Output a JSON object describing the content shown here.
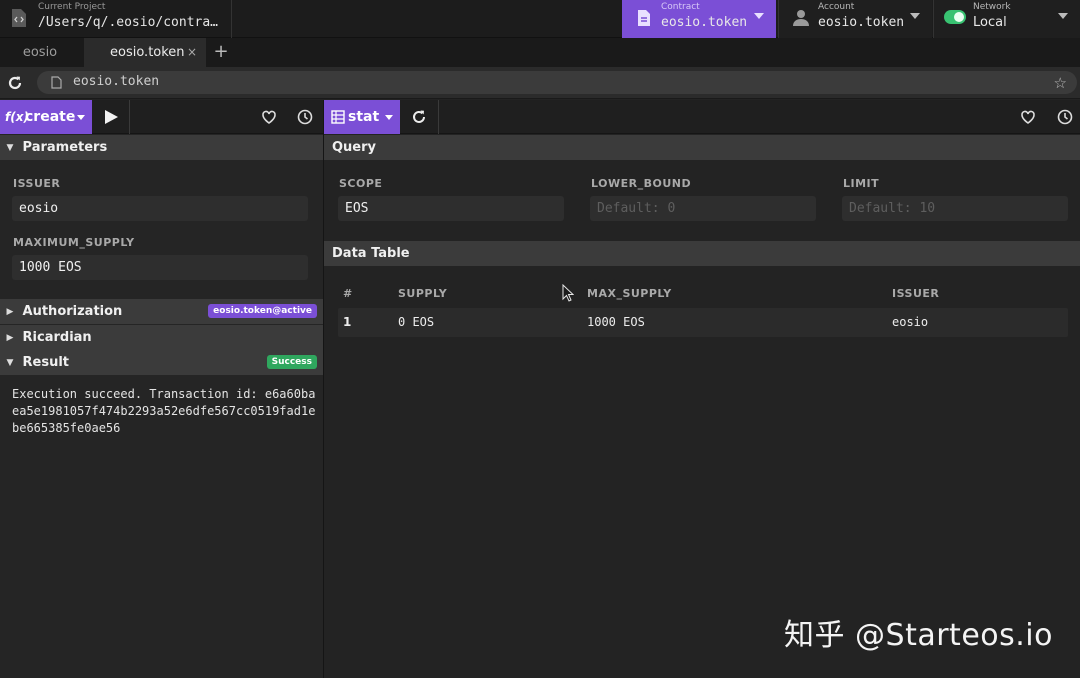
{
  "topbar": {
    "project": {
      "label": "Current Project",
      "value": "/Users/q/.eosio/contra…",
      "icon": "file-code-icon"
    },
    "contract": {
      "label": "Contract",
      "value": "eosio.token",
      "icon": "document-icon"
    },
    "account": {
      "label": "Account",
      "value": "eosio.token",
      "icon": "user-icon"
    },
    "network": {
      "label": "Network",
      "value": "Local",
      "status_color": "#38c271"
    }
  },
  "tabs": [
    {
      "label": "eosio",
      "active": false
    },
    {
      "label": "eosio.token",
      "active": true,
      "close": "×"
    }
  ],
  "tab_add": "+",
  "address_bar": {
    "value": "eosio.token"
  },
  "left_panel": {
    "action": {
      "prefix": "f(x)",
      "label": "create"
    },
    "parameters": {
      "title": "Parameters",
      "fields": [
        {
          "label": "ISSUER",
          "value": "eosio"
        },
        {
          "label": "MAXIMUM_SUPPLY",
          "value": "1000 EOS"
        }
      ]
    },
    "authorization": {
      "title": "Authorization",
      "badge": "eosio.token@active"
    },
    "ricardian": {
      "title": "Ricardian"
    },
    "result": {
      "title": "Result",
      "badge": "Success",
      "text": "Execution succeed. Transaction id: e6a60baea5e1981057f474b2293a52e6dfe567cc0519fad1ebe665385fe0ae56"
    }
  },
  "right_panel": {
    "table_select": {
      "label": "stat"
    },
    "query": {
      "title": "Query",
      "fields": [
        {
          "label": "SCOPE",
          "value": "EOS",
          "placeholder": ""
        },
        {
          "label": "LOWER_BOUND",
          "value": "",
          "placeholder": "Default: 0"
        },
        {
          "label": "LIMIT",
          "value": "",
          "placeholder": "Default: 10"
        }
      ]
    },
    "data_table": {
      "title": "Data Table",
      "columns": [
        "#",
        "SUPPLY",
        "MAX_SUPPLY",
        "ISSUER"
      ],
      "rows": [
        [
          "1",
          "0 EOS",
          "1000 EOS",
          "eosio"
        ]
      ]
    }
  },
  "watermark": "知乎 @Starteos.io",
  "colors": {
    "accent": "#7b4fd6",
    "success": "#2fa75e",
    "background": "#232323"
  }
}
